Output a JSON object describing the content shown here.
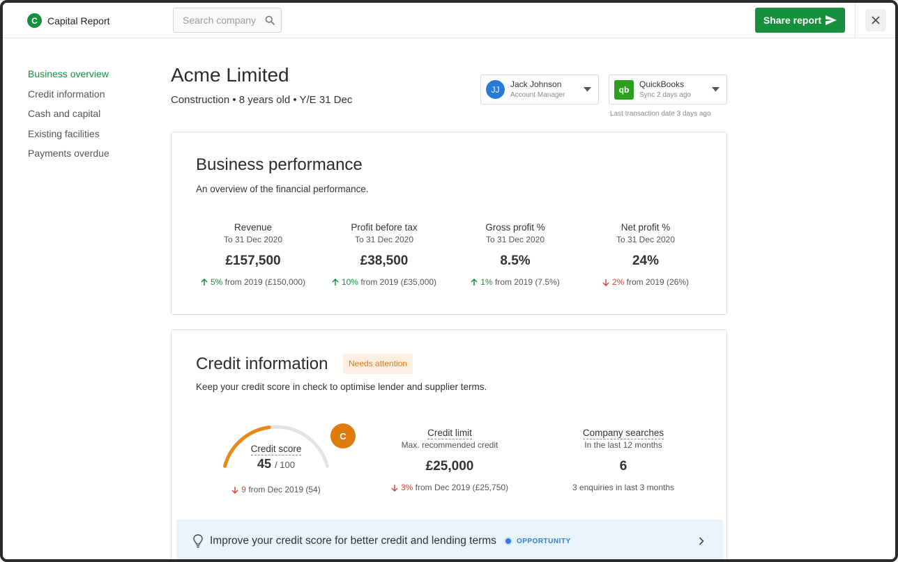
{
  "app": {
    "logo_letter": "C",
    "name": "Capital Report"
  },
  "search": {
    "placeholder": "Search company"
  },
  "header": {
    "share_label": "Share report"
  },
  "sidebar": {
    "items": [
      {
        "label": "Business overview",
        "active": true
      },
      {
        "label": "Credit information"
      },
      {
        "label": "Cash and capital"
      },
      {
        "label": "Existing facilities"
      },
      {
        "label": "Payments overdue"
      }
    ]
  },
  "company": {
    "name": "Acme Limited",
    "subtitle": "Construction • 8 years old • Y/E 31 Dec"
  },
  "account_manager": {
    "initials": "JJ",
    "name": "Jack Johnson",
    "role": "Account Manager"
  },
  "integration": {
    "logo": "qb",
    "name": "QuickBooks",
    "sync": "Sync 2 days ago",
    "last_transaction": "Last transaction date 3 days ago"
  },
  "performance": {
    "title": "Business performance",
    "description": "An overview of the financial performance.",
    "metrics": [
      {
        "label": "Revenue",
        "period": "To 31 Dec 2020",
        "value": "£157,500",
        "direction": "up",
        "change": "5%",
        "from": "from 2019 (£150,000)"
      },
      {
        "label": "Profit before tax",
        "period": "To 31 Dec 2020",
        "value": "£38,500",
        "direction": "up",
        "change": "10%",
        "from": "from 2019 (£35,000)"
      },
      {
        "label": "Gross profit %",
        "period": "To 31 Dec 2020",
        "value": "8.5%",
        "direction": "up",
        "change": "1%",
        "from": "from 2019 (7.5%)"
      },
      {
        "label": "Net profit %",
        "period": "To 31 Dec 2020",
        "value": "24%",
        "direction": "down",
        "change": "2%",
        "from": "from 2019 (26%)"
      }
    ]
  },
  "credit": {
    "title": "Credit information",
    "badge": "Needs attention",
    "description": "Keep your credit score in check to optimise lender and supplier terms.",
    "score": {
      "label": "Credit score",
      "value": "45",
      "max": "/ 100",
      "fraction": 0.45,
      "grade": "C",
      "change": "9",
      "from": "from Dec 2019 (54)"
    },
    "limit": {
      "label": "Credit limit",
      "sub": "Max. recommended credit",
      "value": "£25,000",
      "change": "3%",
      "from": "from Dec 2019 (£25,750)"
    },
    "searches": {
      "label": "Company searches",
      "sub": "In the last 12 months",
      "value": "6",
      "note": "3 enquiries in last 3 months"
    },
    "banner": {
      "text": "Improve your credit score for better credit and lending terms",
      "tag": "OPPORTUNITY"
    }
  },
  "colors": {
    "brand": "#17903d",
    "positive": "#17903d",
    "negative": "#d8453a",
    "warning": "#e07b10",
    "info": "#2f7fd4"
  }
}
